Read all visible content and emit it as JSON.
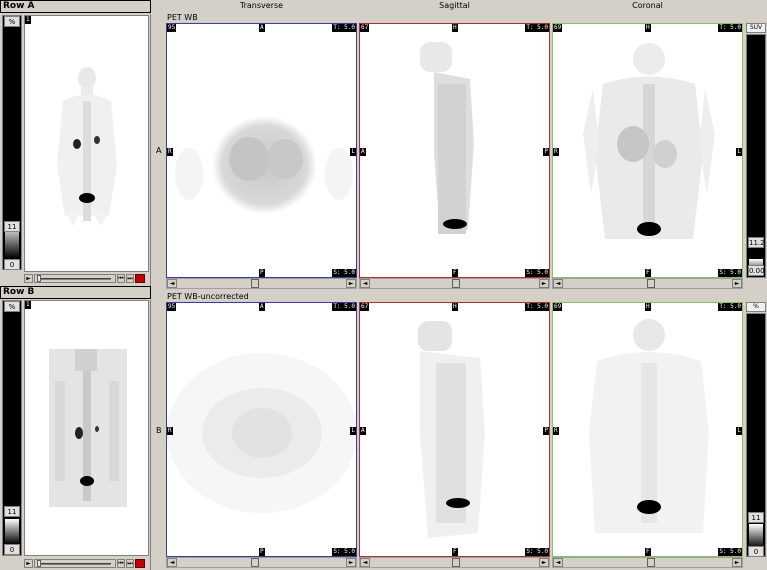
{
  "rows": [
    {
      "title": "Row A",
      "series_name": "PET WB",
      "letter": "A",
      "left_unit": "%",
      "left_top": "11",
      "left_bottom": "0",
      "right_unit": "SUV",
      "right_top": "11.2",
      "right_bottom": "0.00",
      "mip_frame": "1",
      "views": [
        {
          "slice": "95",
          "top": "A",
          "left": "R",
          "right": "L",
          "bottom": "P",
          "thickness": "T: 5.0",
          "spacing": "S: 5.0"
        },
        {
          "slice": "67",
          "top": "H",
          "left": "A",
          "right": "P",
          "bottom": "F",
          "thickness": "T: 5.0",
          "spacing": "S: 5.0"
        },
        {
          "slice": "69",
          "top": "H",
          "left": "R",
          "right": "L",
          "bottom": "F",
          "thickness": "T: 5.0",
          "spacing": "S: 5.0"
        }
      ]
    },
    {
      "title": "Row B",
      "series_name": "PET WB-uncorrected",
      "letter": "B",
      "left_unit": "%",
      "left_top": "11",
      "left_bottom": "0",
      "right_unit": "%",
      "right_top": "11",
      "right_bottom": "0",
      "mip_frame": "1",
      "views": [
        {
          "slice": "95",
          "top": "A",
          "left": "R",
          "right": "L",
          "bottom": "P",
          "thickness": "T: 5.0",
          "spacing": "S: 5.0"
        },
        {
          "slice": "67",
          "top": "H",
          "left": "A",
          "right": "P",
          "bottom": "F",
          "thickness": "T: 5.0",
          "spacing": "S: 5.0"
        },
        {
          "slice": "69",
          "top": "H",
          "left": "R",
          "right": "L",
          "bottom": "F",
          "thickness": "T: 5.0",
          "spacing": "S: 5.0"
        }
      ]
    }
  ],
  "columns": [
    "Transverse",
    "Sagittal",
    "Coronal"
  ],
  "view_border_colors": [
    "#3a3aa0",
    "#b03030",
    "#8cc060"
  ],
  "cine_controls": [
    "play-icon",
    "first-frame-icon",
    "last-frame-icon",
    "lock-icon"
  ],
  "scroll_arrows": {
    "left": "◄",
    "right": "►"
  }
}
